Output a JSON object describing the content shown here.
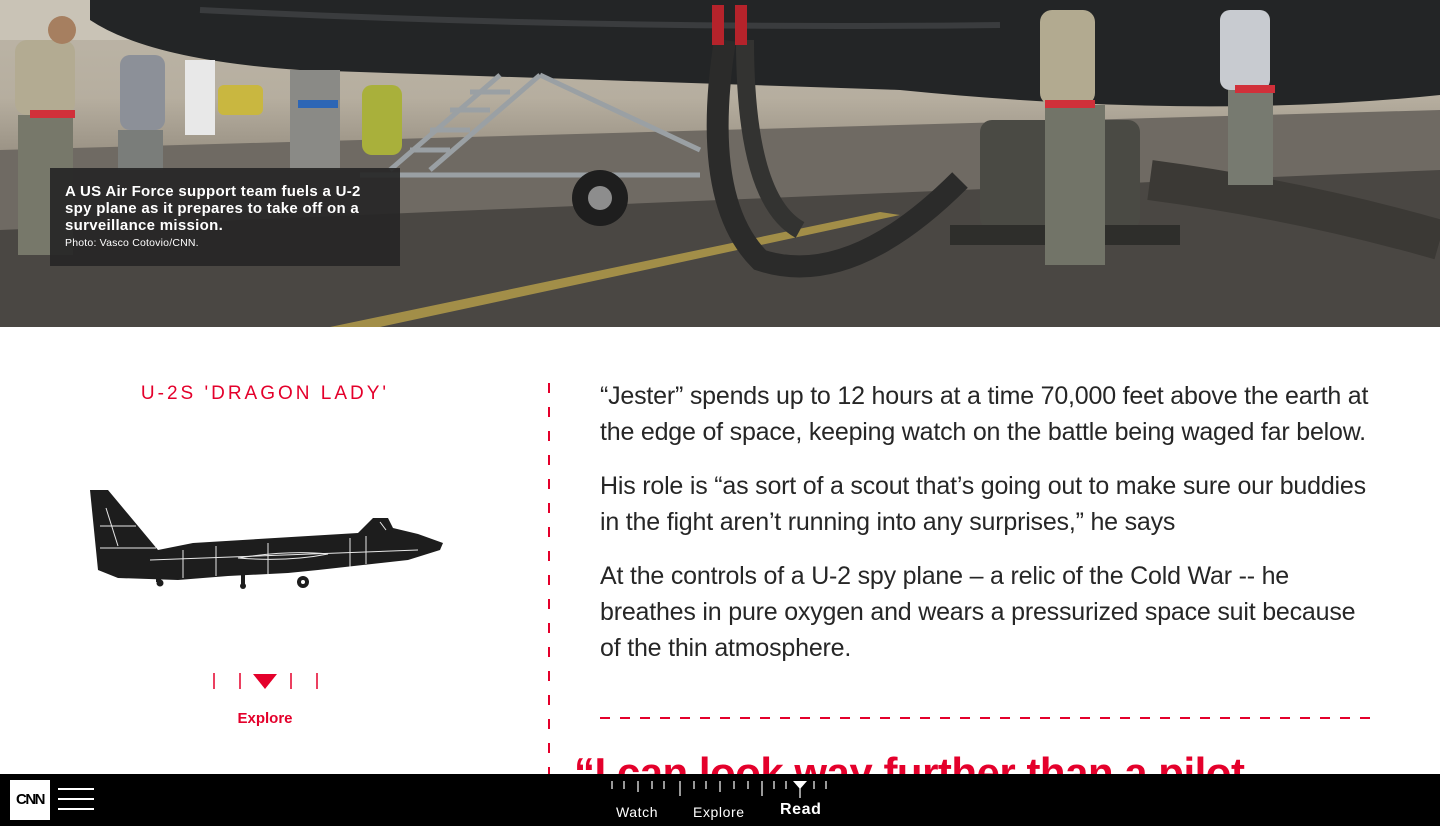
{
  "hero": {
    "caption": "A US Air Force support team fuels a U-2 spy plane as it prepares to take off on a surveillance mission.",
    "credit": "Photo: Vasco Cotovio/CNN."
  },
  "aircraft": {
    "title": "U-2S 'DRAGON LADY'",
    "explore_label": "Explore",
    "silhouette_icon": "u2-plane-silhouette",
    "scrubber_icon": "triangle-down-icon"
  },
  "article": {
    "paragraphs": [
      "“Jester” spends up to 12 hours at a time 70,000 feet above the earth at the edge of space, keeping watch on the battle being waged far below.",
      "His role is “as sort of a scout that’s going out to make sure our buddies in the fight aren’t running into any surprises,” he says",
      "At the controls of a U-2 spy plane – a relic of the Cold War -- he breathes in pure oxygen and wears a pressurized space suit because of the thin atmosphere."
    ],
    "pull_quote": "“I can look way further than a pilot"
  },
  "bottom_nav": {
    "logo": "CNN",
    "menu_icon": "hamburger-menu-icon",
    "items": [
      {
        "label": "Watch",
        "active": false
      },
      {
        "label": "Explore",
        "active": false
      },
      {
        "label": "Read",
        "active": true
      }
    ]
  },
  "colors": {
    "accent": "#e4002b",
    "text": "#262626",
    "bar": "#000000"
  }
}
